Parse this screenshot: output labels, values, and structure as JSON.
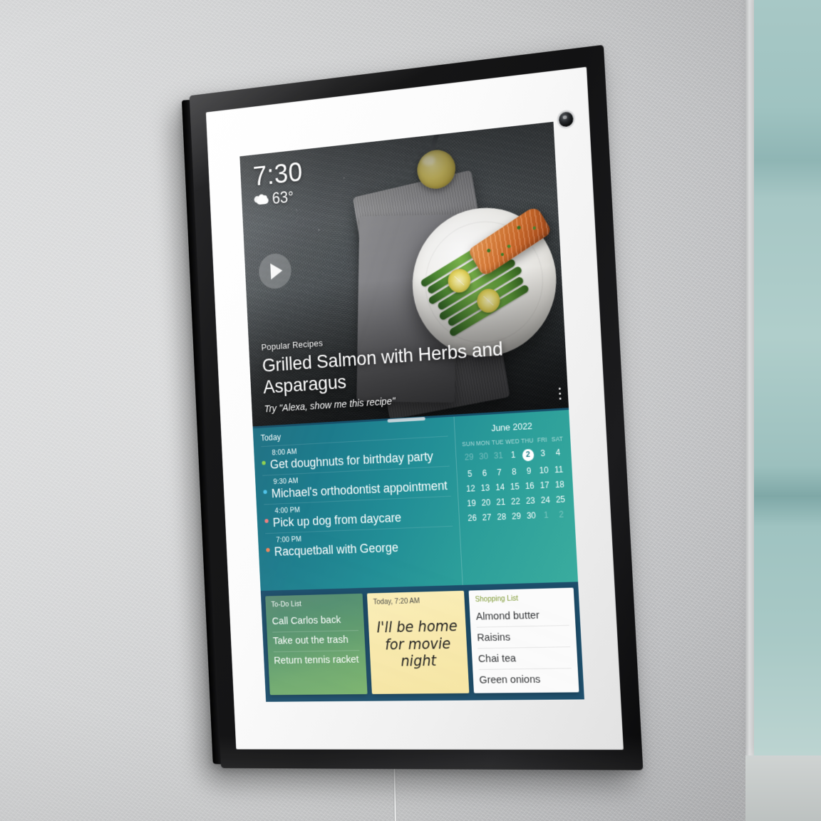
{
  "device": {
    "name": "wall-mounted smart display",
    "camera_icon": "camera-lens-icon"
  },
  "screen": {
    "status": {
      "time": "7:30",
      "temperature": "63°",
      "weather_icon": "partly-cloudy-icon"
    },
    "hero": {
      "play_icon": "play-icon",
      "kicker": "Popular Recipes",
      "title": "Grilled Salmon with Herbs and Asparagus",
      "prompt": "Try \"Alexa, show me this recipe\"",
      "overflow_icon": "kebab-menu-icon",
      "drag_handle": "drag-handle"
    },
    "agenda": {
      "heading": "Today",
      "events": [
        {
          "time": "8:00 AM",
          "title": "Get doughnuts for birthday party",
          "dot_color": "#8fd14f"
        },
        {
          "time": "9:30 AM",
          "title": "Michael's orthodontist appointment",
          "dot_color": "#4fc3e8"
        },
        {
          "time": "4:00 PM",
          "title": "Pick up dog from daycare",
          "dot_color": "#f07f7f"
        },
        {
          "time": "7:00 PM",
          "title": "Racquetball with George",
          "dot_color": "#f2855c"
        }
      ]
    },
    "calendar": {
      "title": "June 2022",
      "weekdays": [
        "SUN",
        "MON",
        "TUE",
        "WED",
        "THU",
        "FRI",
        "SAT"
      ],
      "selected_day": 2,
      "weeks": [
        [
          {
            "n": "29",
            "dim": true
          },
          {
            "n": "30",
            "dim": true
          },
          {
            "n": "31",
            "dim": true
          },
          {
            "n": "1",
            "dim": false
          },
          {
            "n": "2",
            "dim": false,
            "today": true
          },
          {
            "n": "3",
            "dim": false
          },
          {
            "n": "4",
            "dim": false
          }
        ],
        [
          {
            "n": "5",
            "dim": false
          },
          {
            "n": "6",
            "dim": false
          },
          {
            "n": "7",
            "dim": false
          },
          {
            "n": "8",
            "dim": false
          },
          {
            "n": "9",
            "dim": false
          },
          {
            "n": "10",
            "dim": false
          },
          {
            "n": "11",
            "dim": false
          }
        ],
        [
          {
            "n": "12",
            "dim": false
          },
          {
            "n": "13",
            "dim": false
          },
          {
            "n": "14",
            "dim": false
          },
          {
            "n": "15",
            "dim": false
          },
          {
            "n": "16",
            "dim": false
          },
          {
            "n": "17",
            "dim": false
          },
          {
            "n": "18",
            "dim": false
          }
        ],
        [
          {
            "n": "19",
            "dim": false
          },
          {
            "n": "20",
            "dim": false
          },
          {
            "n": "21",
            "dim": false
          },
          {
            "n": "22",
            "dim": false
          },
          {
            "n": "23",
            "dim": false
          },
          {
            "n": "24",
            "dim": false
          },
          {
            "n": "25",
            "dim": false
          }
        ],
        [
          {
            "n": "26",
            "dim": false
          },
          {
            "n": "27",
            "dim": false
          },
          {
            "n": "28",
            "dim": false
          },
          {
            "n": "29",
            "dim": false
          },
          {
            "n": "30",
            "dim": false
          },
          {
            "n": "1",
            "dim": true
          },
          {
            "n": "2",
            "dim": true
          }
        ]
      ]
    },
    "widgets": {
      "todo": {
        "heading": "To-Do List",
        "items": [
          "Call Carlos back",
          "Take out the trash",
          "Return tennis racket"
        ]
      },
      "note": {
        "timestamp": "Today, 7:20 AM",
        "body": "I'll be home for movie night"
      },
      "shopping": {
        "heading": "Shopping List",
        "items": [
          "Almond butter",
          "Raisins",
          "Chai tea",
          "Green onions"
        ]
      }
    }
  },
  "colors": {
    "agenda_teal_start": "#1d6f82",
    "agenda_teal_end": "#3aac9e",
    "widget_tray": "#1d4e6b",
    "todo_green_start": "#5b8a73",
    "todo_green_end": "#7ab36d",
    "note_yellow": "#f8e9ad",
    "shopping_heading": "#7f9a33",
    "wall": "#c9cacb",
    "cabinet_teal": "#a8c8c6"
  }
}
